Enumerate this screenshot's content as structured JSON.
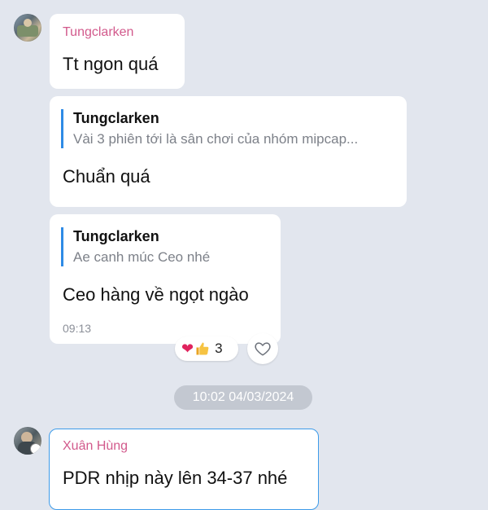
{
  "messages": [
    {
      "sender": "Tungclarken",
      "text": "Tt ngon quá"
    },
    {
      "quote": {
        "author": "Tungclarken",
        "text": "Vài 3 phiên tới là sân chơi của nhóm mipcap..."
      },
      "text": "Chuẩn  quá"
    },
    {
      "quote": {
        "author": "Tungclarken",
        "text": "Ae canh múc Ceo nhé"
      },
      "text": "Ceo hàng về ngọt ngào",
      "time": "09:13",
      "reactions": {
        "emojis": [
          "heart",
          "thumbs-up"
        ],
        "count": "3"
      }
    },
    {
      "sender": "Xuân Hùng",
      "text": "PDR nhịp này lên 34-37 nhé"
    }
  ],
  "date_separator": "10:02 04/03/2024",
  "colors": {
    "background": "#e2e6ee",
    "sender_name": "#d25a8c",
    "quote_bar": "#2e8be6",
    "date_pill": "#c3c8d1",
    "selected_outline": "#3d9be9"
  },
  "icons": {
    "reaction_heart": "heart-icon",
    "reaction_thumb": "thumbs-up-icon",
    "add_reaction": "heart-outline-icon"
  }
}
